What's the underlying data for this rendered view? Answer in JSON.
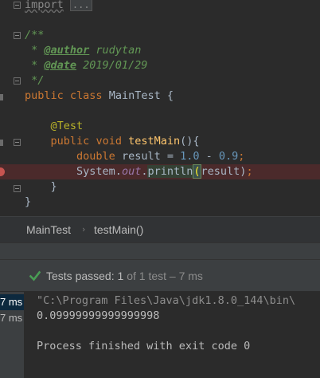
{
  "editor": {
    "lines": {
      "import_keyword": "import",
      "import_fold": "...",
      "doc_open": "/**",
      "author_prefix": " * ",
      "author_tag": "@author",
      "author_value": " rudytan",
      "date_prefix": " * ",
      "date_tag": "@date",
      "date_value": " 2019/01/29",
      "doc_close": " */",
      "class_kw_public": "public",
      "class_kw_class": "class",
      "class_name": "MainTest",
      "class_brace": "{",
      "annotation": "@Test",
      "method_kw_public": "public",
      "method_kw_void": "void",
      "method_name": "testMain",
      "method_sig_rest": "(){",
      "double_kw": "double",
      "result_decl": " result = ",
      "num_a": "1.0",
      "minus": " - ",
      "num_b": "0.9",
      "semicolon": ";",
      "system": "System.",
      "out_field": "out",
      "dot": ".",
      "println": "println",
      "paren_open": "(",
      "arg": "result",
      "paren_close": ")",
      "end_semicolon": ";",
      "method_close": "}",
      "class_close": "}"
    }
  },
  "breadcrumb": {
    "class": "MainTest",
    "separator": "›",
    "method": "testMain()"
  },
  "test_status": {
    "label": "Tests passed:",
    "count": "1",
    "of": "of",
    "total": "1 test",
    "duration": "– 7 ms",
    "accent_color": "#499c54"
  },
  "test_tree": {
    "rows": [
      "7 ms",
      "7 ms"
    ]
  },
  "console": {
    "command": "\"C:\\Program Files\\Java\\jdk1.8.0_144\\bin\\",
    "output": "0.09999999999999998",
    "exit_message": "Process finished with exit code 0"
  }
}
